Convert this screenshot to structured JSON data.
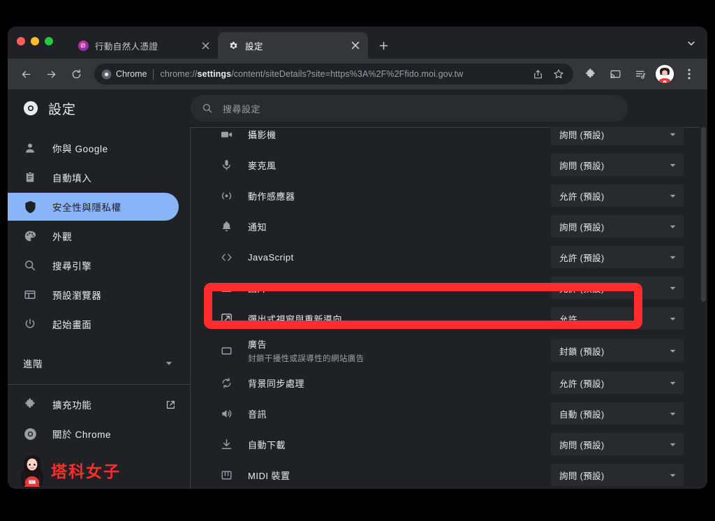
{
  "window": {
    "traffic_lights": [
      "close",
      "minimize",
      "maximize"
    ]
  },
  "tabs": [
    {
      "title": "行動自然人憑證",
      "favicon": "moi-icon",
      "active": false,
      "close_label": "×"
    },
    {
      "title": "設定",
      "favicon": "gear-icon",
      "active": true,
      "close_label": "×"
    }
  ],
  "tabstrip": {
    "new_tab_label": "+",
    "tab_search_label": "⌄"
  },
  "toolbar": {
    "back_label": "←",
    "forward_label": "→",
    "reload_label": "⟳",
    "omnibox": {
      "chip_label": "Chrome",
      "url_prefix": "chrome://",
      "url_bold": "settings",
      "url_suffix": "/content/siteDetails?site=https%3A%2F%2Ffido.moi.gov.tw",
      "full_url": "chrome://settings/content/siteDetails?site=https%3A%2F%2Ffido.moi.gov.tw"
    },
    "actions": [
      "share-icon",
      "bookmark-star-icon"
    ],
    "right_icons": [
      "extensions-puzzle-icon",
      "cast-icon",
      "reading-list-icon",
      "avatar",
      "more-menu-icon"
    ]
  },
  "settings": {
    "title": "設定",
    "search": {
      "placeholder": "搜尋設定"
    },
    "sidebar": {
      "items": [
        {
          "label": "你與 Google",
          "icon": "person-icon",
          "selected": false
        },
        {
          "label": "自動填入",
          "icon": "clipboard-icon",
          "selected": false
        },
        {
          "label": "安全性與隱私權",
          "icon": "shield-icon",
          "selected": true
        },
        {
          "label": "外觀",
          "icon": "palette-icon",
          "selected": false
        },
        {
          "label": "搜尋引擎",
          "icon": "search-icon",
          "selected": false
        },
        {
          "label": "預設瀏覽器",
          "icon": "browser-window-icon",
          "selected": false
        },
        {
          "label": "起始畫面",
          "icon": "power-icon",
          "selected": false
        }
      ],
      "advanced": {
        "label": "進階",
        "icon": "chevron-down-icon"
      },
      "footer": [
        {
          "label": "擴充功能",
          "icon": "puzzle-icon",
          "trailing_icon": "external-link-icon"
        },
        {
          "label": "關於 Chrome",
          "icon": "chrome-icon",
          "trailing_icon": null
        }
      ],
      "watermark": {
        "text": "塔科女子",
        "color": "#ff2d2d"
      }
    },
    "permission_rows": [
      {
        "label": "攝影機",
        "sub": null,
        "icon": "camera-icon",
        "value": "詢問 (預設)",
        "highlighted": false
      },
      {
        "label": "麥克風",
        "sub": null,
        "icon": "microphone-icon",
        "value": "詢問 (預設)",
        "highlighted": false
      },
      {
        "label": "動作感應器",
        "sub": null,
        "icon": "motion-sensor-icon",
        "value": "允許 (預設)",
        "highlighted": false
      },
      {
        "label": "通知",
        "sub": null,
        "icon": "bell-icon",
        "value": "詢問 (預設)",
        "highlighted": false
      },
      {
        "label": "JavaScript",
        "sub": null,
        "icon": "code-icon",
        "value": "允許 (預設)",
        "highlighted": false
      },
      {
        "label": "圖片",
        "sub": null,
        "icon": "image-icon",
        "value": "允許 (預設)",
        "highlighted": false
      },
      {
        "label": "彈出式視窗與重新導向",
        "sub": null,
        "icon": "popup-redirect-icon",
        "value": "允許",
        "highlighted": true
      },
      {
        "label": "廣告",
        "sub": "封鎖干擾性或誤導性的網站廣告",
        "icon": "ads-icon",
        "value": "封鎖 (預設)",
        "highlighted": false
      },
      {
        "label": "背景同步處理",
        "sub": null,
        "icon": "sync-icon",
        "value": "允許 (預設)",
        "highlighted": false
      },
      {
        "label": "音訊",
        "sub": null,
        "icon": "sound-icon",
        "value": "自動 (預設)",
        "highlighted": false
      },
      {
        "label": "自動下載",
        "sub": null,
        "icon": "download-icon",
        "value": "詢問 (預設)",
        "highlighted": false
      },
      {
        "label": "MIDI 裝置",
        "sub": null,
        "icon": "midi-icon",
        "value": "詢問 (預設)",
        "highlighted": false
      }
    ]
  },
  "annotation": {
    "color": "#ff2d2d",
    "target_label": "彈出式視窗與重新導向"
  },
  "colors": {
    "page_bg": "#202124",
    "toolbar_bg": "#35363a",
    "tabstrip_bg": "#202124",
    "accent": "#8ab4f8",
    "select_bg": "#292a2d",
    "text_primary": "#e8eaed",
    "text_secondary": "#9aa0a6",
    "annotation_red": "#ff2d2d"
  }
}
